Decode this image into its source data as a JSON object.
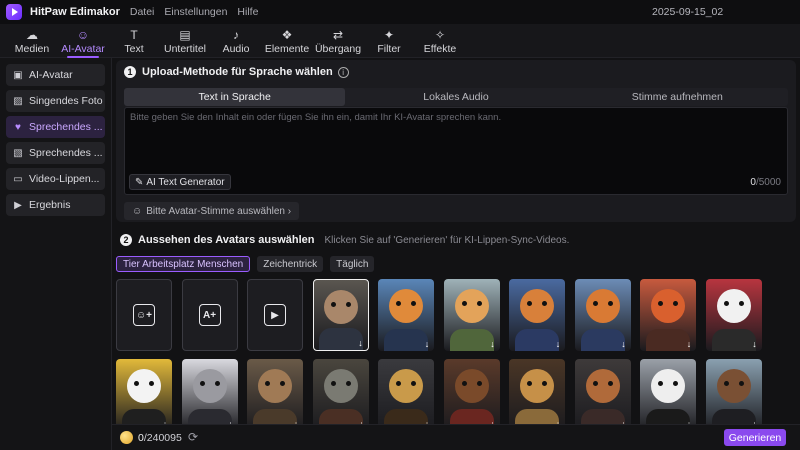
{
  "app": {
    "title": "HitPaw Edimakor",
    "menu": [
      "Datei",
      "Einstellungen",
      "Hilfe"
    ],
    "date": "2025-09-15_02"
  },
  "toolbar": [
    {
      "label": "Medien",
      "icon": "media-icon",
      "glyph": "☁"
    },
    {
      "label": "AI-Avatar",
      "icon": "ai-avatar-icon",
      "glyph": "☺",
      "active": true
    },
    {
      "label": "Text",
      "icon": "text-icon",
      "glyph": "T"
    },
    {
      "label": "Untertitel",
      "icon": "subtitle-icon",
      "glyph": "▤"
    },
    {
      "label": "Audio",
      "icon": "audio-icon",
      "glyph": "♪"
    },
    {
      "label": "Elemente",
      "icon": "elements-icon",
      "glyph": "❖"
    },
    {
      "label": "Übergang",
      "icon": "transition-icon",
      "glyph": "⇄"
    },
    {
      "label": "Filter",
      "icon": "filter-icon",
      "glyph": "✦"
    },
    {
      "label": "Effekte",
      "icon": "effects-icon",
      "glyph": "✧"
    }
  ],
  "sidebar": {
    "items": [
      {
        "label": "AI-Avatar",
        "icon": "avatar-icon",
        "glyph": "▣"
      },
      {
        "label": "Singendes Foto",
        "icon": "photo-icon",
        "glyph": "▨"
      },
      {
        "label": "Sprechendes ...",
        "icon": "talking-icon",
        "glyph": "♥",
        "active": true
      },
      {
        "label": "Sprechendes ...",
        "icon": "talking-photo-icon",
        "glyph": "▧"
      },
      {
        "label": "Video-Lippen...",
        "icon": "lipsync-icon",
        "glyph": "▭"
      },
      {
        "label": "Ergebnis",
        "icon": "result-icon",
        "glyph": "▶"
      }
    ]
  },
  "upload": {
    "number": "1",
    "title": "Upload-Methode für Sprache wählen",
    "tabs": [
      "Text in Sprache",
      "Lokales Audio",
      "Stimme aufnehmen"
    ],
    "placeholder": "Bitte geben Sie den Inhalt ein oder fügen Sie ihn ein, damit Ihr KI-Avatar sprechen kann.",
    "ai_generator": "AI Text Generator",
    "count": "0",
    "max": "/5000",
    "voice_button": "Bitte Avatar-Stimme auswählen ›"
  },
  "avatars": {
    "number": "2",
    "title": "Aussehen des Avatars auswählen",
    "hint": "Klicken Sie auf 'Generieren' für KI-Lippen-Sync-Videos.",
    "filters": [
      {
        "label": "Tier Arbeitsplatz Menschen",
        "active": true
      },
      {
        "label": "Zeichentrick"
      },
      {
        "label": "Täglich"
      }
    ],
    "upload_tiles": [
      {
        "icon": "portrait-upload-icon",
        "glyph": "☺+"
      },
      {
        "icon": "ai-image-icon",
        "glyph": "A+"
      },
      {
        "icon": "video-avatar-icon",
        "glyph": "▶"
      }
    ],
    "row1": [
      {
        "name": "cat-avatar",
        "face": "#a9876a",
        "body": "#2d3340",
        "bg": "#5a5650",
        "selected": true
      },
      {
        "name": "orange-cat-avatar",
        "face": "#e08a3a",
        "body": "#26344f",
        "bg": "#5a86b8"
      },
      {
        "name": "ginger-cat-avatar",
        "face": "#e3a35a",
        "body": "#50663b",
        "bg": "#9fb2b8"
      },
      {
        "name": "fox-avatar",
        "face": "#d8803a",
        "body": "#2b3a63",
        "bg": "#4a6aa0"
      },
      {
        "name": "fox-office-avatar",
        "face": "#d97a34",
        "body": "#2b3a60",
        "bg": "#6c8cb6"
      },
      {
        "name": "red-fox-avatar",
        "face": "#d9602e",
        "body": "#4a2a22",
        "bg": "#c75a3e"
      },
      {
        "name": "panda-avatar",
        "face": "#f1f1f1",
        "body": "#2a2a2a",
        "bg": "#b8353f"
      }
    ],
    "row2": [
      {
        "name": "panda-yellow-avatar",
        "face": "#f3f3f3",
        "body": "#1f1f1f",
        "bg": "#e2b93a"
      },
      {
        "name": "raccoon-avatar",
        "face": "#9a9aa0",
        "body": "#2a2a30",
        "bg": "#d9d9df"
      },
      {
        "name": "kangaroo-avatar",
        "face": "#a07a55",
        "body": "#4a3a2a",
        "bg": "#6a5a48"
      },
      {
        "name": "wolf-avatar",
        "face": "#7a7a72",
        "body": "#4a2f24",
        "bg": "#4a463e"
      },
      {
        "name": "leopard-avatar",
        "face": "#c99a4a",
        "body": "#3a2a1a",
        "bg": "#3a3a3e"
      },
      {
        "name": "bear-avatar",
        "face": "#7a4a2a",
        "body": "#6a2620",
        "bg": "#5a3a2a"
      },
      {
        "name": "lion-avatar",
        "face": "#c69048",
        "body": "#8a6a3a",
        "bg": "#4a3626"
      },
      {
        "name": "dog-avatar",
        "face": "#b06a3a",
        "body": "#3a2a28",
        "bg": "#3e3a3a"
      },
      {
        "name": "sunglasses-panda-avatar",
        "face": "#eeeeee",
        "body": "#1a1a1a",
        "bg": "#9aa0a8"
      },
      {
        "name": "beaver-avatar",
        "face": "#7a5034",
        "body": "#1e1e22",
        "bg": "#8aa0b0"
      }
    ]
  },
  "bottom": {
    "credits": "0",
    "credits_total": "/240095",
    "generate": "Generieren"
  },
  "colors": {
    "accent": "#8a49ee",
    "accent_light": "#b58bff"
  }
}
